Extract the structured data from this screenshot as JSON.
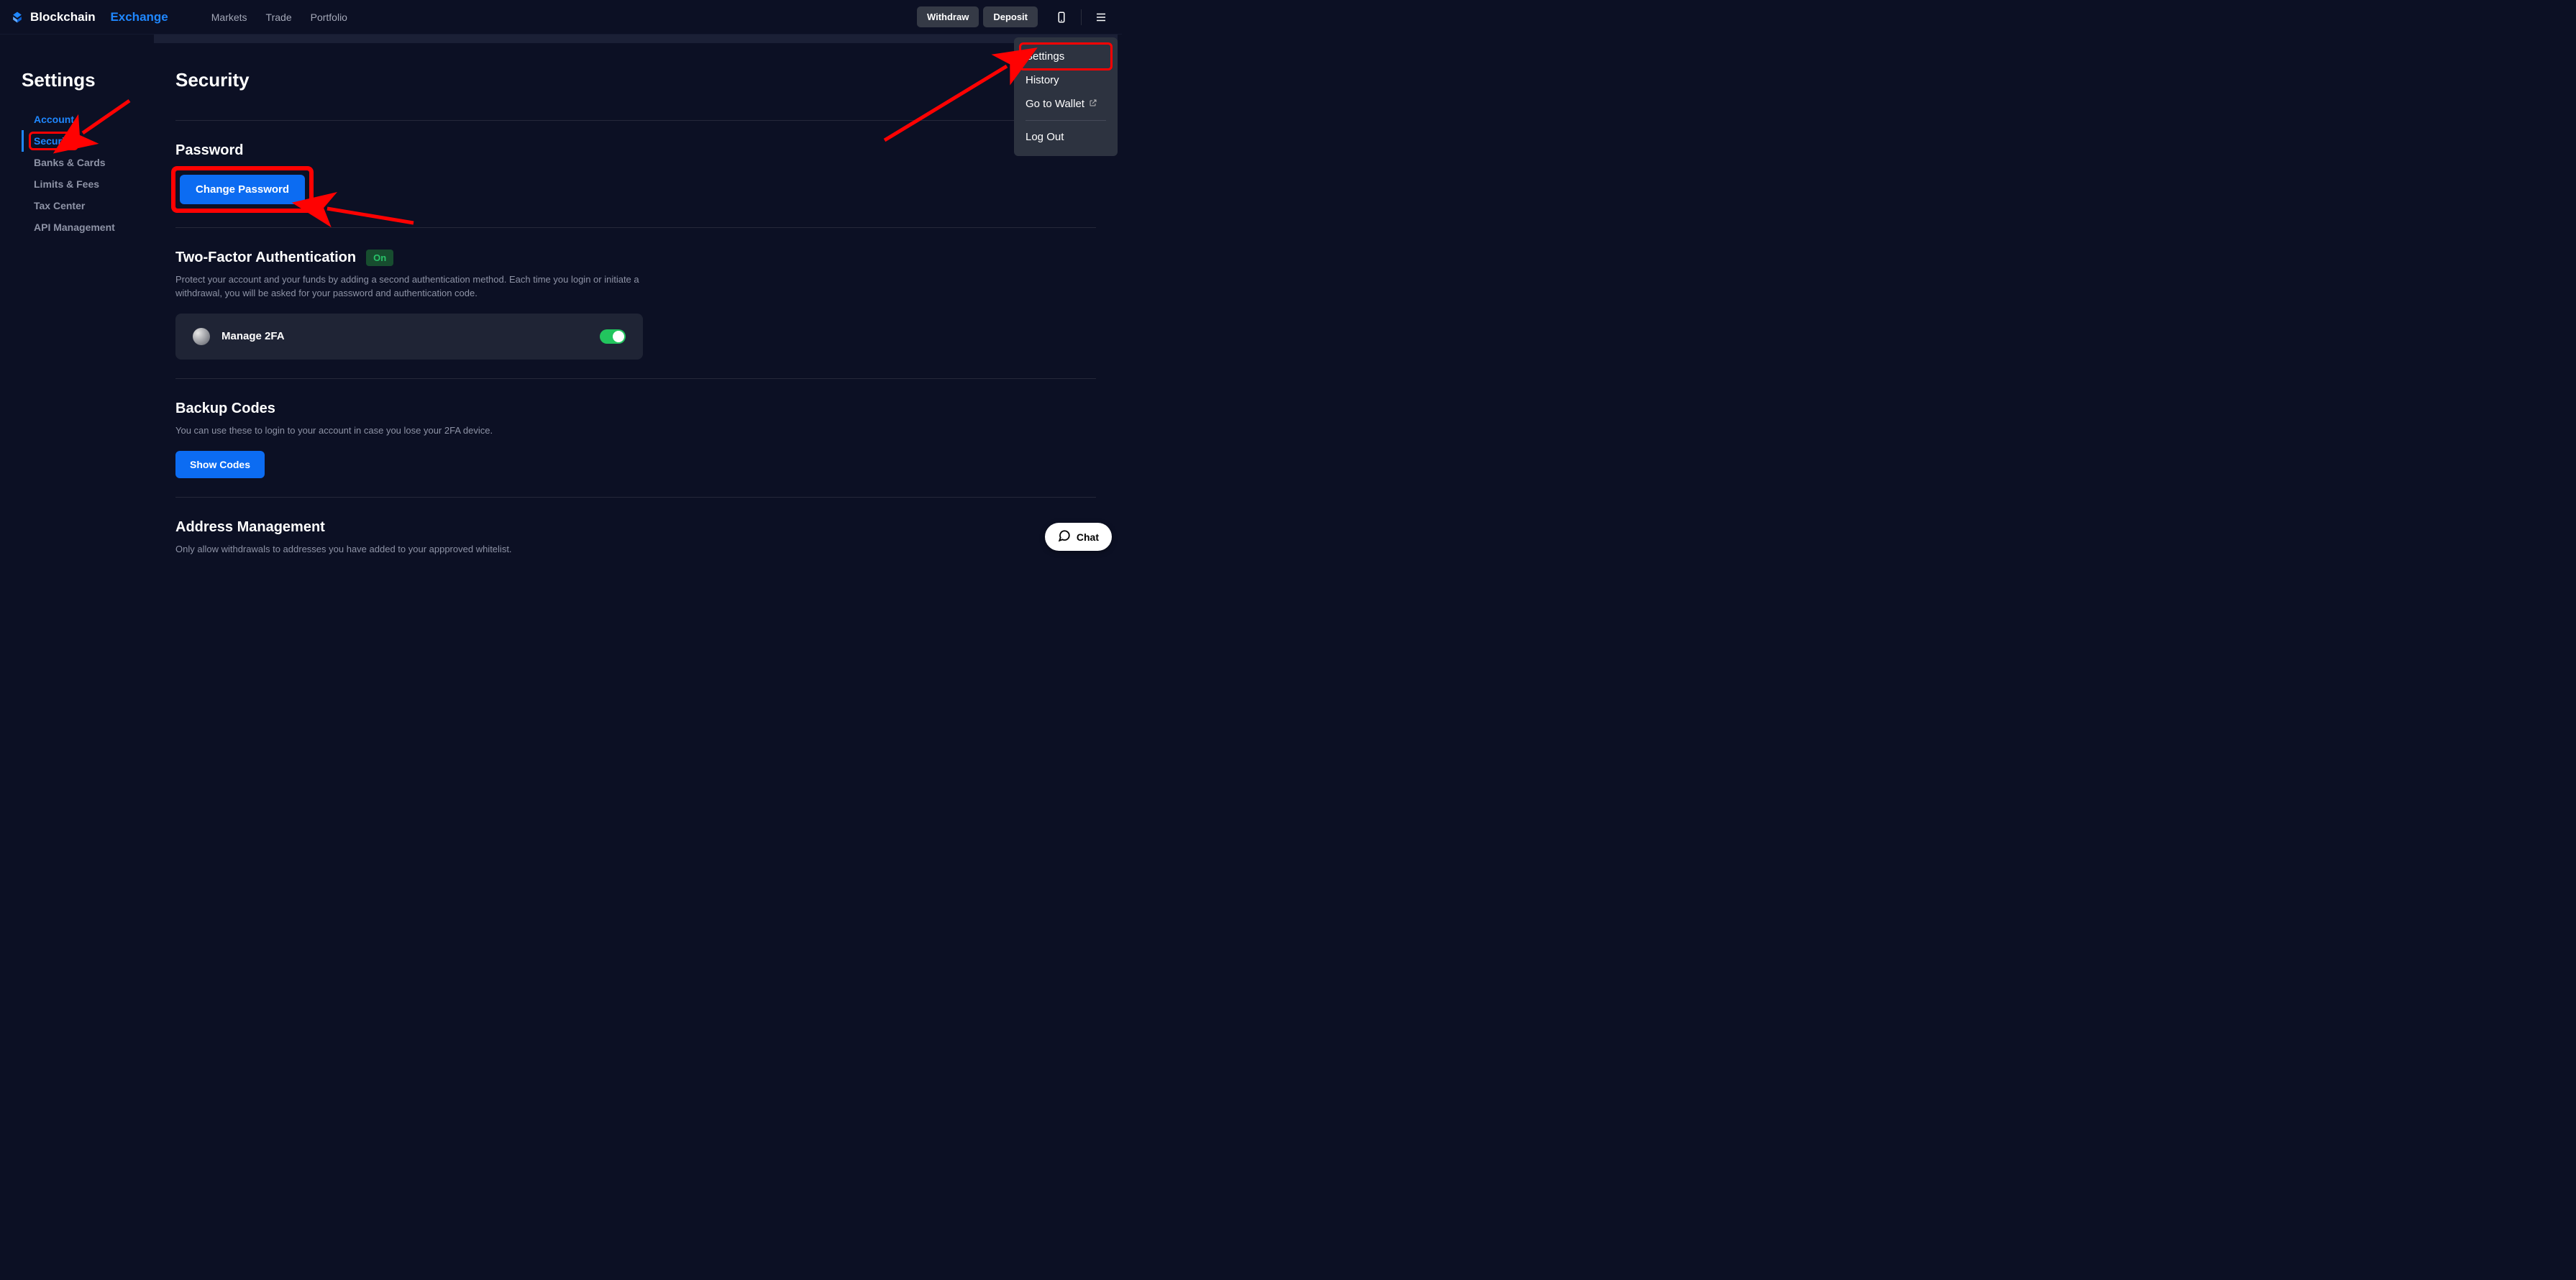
{
  "brand": {
    "a": "Blockchain",
    "b": "Exchange"
  },
  "nav": {
    "markets": "Markets",
    "trade": "Trade",
    "portfolio": "Portfolio"
  },
  "topbar": {
    "withdraw": "Withdraw",
    "deposit": "Deposit"
  },
  "dropdown": {
    "settings": "Settings",
    "history": "History",
    "wallet": "Go to Wallet",
    "logout": "Log Out"
  },
  "sidebar": {
    "title": "Settings",
    "items": {
      "account": "Account",
      "security": "Security",
      "banks": "Banks & Cards",
      "limits": "Limits & Fees",
      "tax": "Tax Center",
      "api": "API Management"
    }
  },
  "page": {
    "title": "Security",
    "password": {
      "heading": "Password",
      "button": "Change Password"
    },
    "tfa": {
      "heading": "Two-Factor Authentication",
      "badge": "On",
      "desc": "Protect your account and your funds by adding a second authentication method. Each time you login or initiate a withdrawal, you will be asked for your password and authentication code.",
      "card_label": "Manage 2FA"
    },
    "backup": {
      "heading": "Backup Codes",
      "desc": "You can use these to login to your account in case you lose your 2FA device.",
      "button": "Show Codes"
    },
    "addr": {
      "heading": "Address Management",
      "desc": "Only allow withdrawals to addresses you have added to your appproved whitelist."
    }
  },
  "chat": "Chat"
}
